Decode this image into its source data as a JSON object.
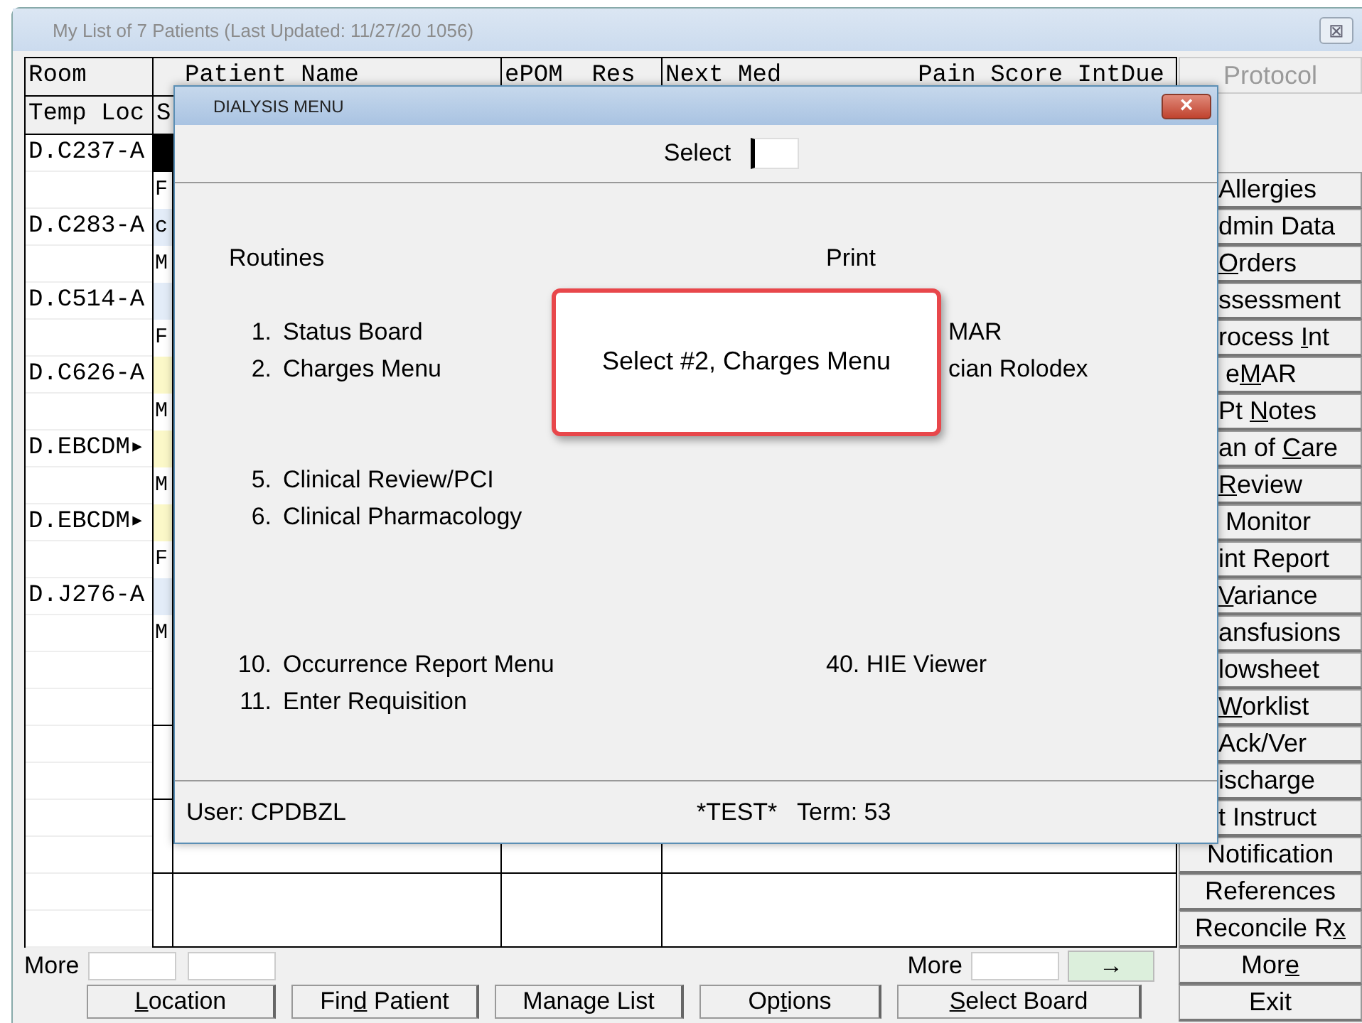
{
  "window": {
    "title": "My List of 7 Patients (Last Updated: 11/27/20  1056)",
    "close": "⊠"
  },
  "table": {
    "header_1": {
      "room": "Room",
      "patient_name": "Patient Name",
      "epom_res": "ePOM  Res",
      "next_med": "Next Med",
      "pain_score": "Pain Score IntDue"
    },
    "header_2": {
      "room": "Temp Loc",
      "status": "S"
    },
    "rows": [
      {
        "room": "D.C237-A",
        "status": [
          {
            "color": "#000000"
          },
          {
            "text": "F",
            "color": "#ffffff"
          }
        ]
      },
      {
        "room": "D.C283-A",
        "status": [
          {
            "text": "c",
            "color": "#e3ecf8"
          },
          {
            "text": "M",
            "color": "#ffffff"
          }
        ]
      },
      {
        "room": "D.C514-A",
        "status": [
          {
            "color": "#e3ecf8"
          },
          {
            "text": "F",
            "color": "#ffffff"
          }
        ]
      },
      {
        "room": "D.C626-A",
        "status": [
          {
            "color": "#fbf8c8"
          },
          {
            "text": "M",
            "color": "#ffffff"
          }
        ]
      },
      {
        "room": "D.EBCDM▸",
        "status": [
          {
            "color": "#fbf8c8"
          },
          {
            "text": "M",
            "color": "#ffffff"
          }
        ]
      },
      {
        "room": "D.EBCDM▸",
        "status": [
          {
            "color": "#fbf8c8"
          },
          {
            "text": "F",
            "color": "#ffffff"
          }
        ]
      },
      {
        "room": "D.J276-A",
        "status": [
          {
            "color": "#e3ecf8"
          },
          {
            "text": "M",
            "color": "#ffffff"
          }
        ]
      },
      {},
      {},
      {},
      {}
    ]
  },
  "bottom": {
    "left_label": "More",
    "right_label": "More",
    "arrow": "→",
    "buttons": [
      {
        "key": "L",
        "after": "ocation"
      },
      {
        "before": "Fin",
        "key": "d",
        "after": " Patient"
      },
      {
        "before": "Mana",
        "key": "g",
        "after": "e List"
      },
      {
        "before": "Op",
        "key": "t",
        "after": "ions"
      },
      {
        "key": "S",
        "after": "elect Board"
      }
    ]
  },
  "side": {
    "protocol": {
      "label": "Protocol",
      "disabled": true
    },
    "buttons": [
      {
        "kind": "covered",
        "before": "Allergies"
      },
      {
        "kind": "covered",
        "before": "dmin Data"
      },
      {
        "kind": "covered",
        "key": "O",
        "after": "rders"
      },
      {
        "kind": "covered",
        "before": "ssessment"
      },
      {
        "kind": "covered",
        "before": "rocess ",
        "key": "I",
        "after": "nt"
      },
      {
        "kind": "covered",
        "before": " e",
        "key": "M",
        "after": "AR"
      },
      {
        "kind": "covered",
        "before": "Pt ",
        "key": "N",
        "after": "otes"
      },
      {
        "kind": "covered",
        "before": "an of ",
        "key": "C",
        "after": "are"
      },
      {
        "kind": "covered",
        "key": "R",
        "after": "eview"
      },
      {
        "kind": "covered",
        "before": " Monitor"
      },
      {
        "kind": "covered",
        "before": "int Report"
      },
      {
        "kind": "covered",
        "key": "V",
        "after": "ariance"
      },
      {
        "kind": "covered",
        "before": "ansfusions"
      },
      {
        "kind": "covered",
        "before": "lowsheet"
      },
      {
        "kind": "covered",
        "key": "W",
        "after": "orklist"
      },
      {
        "kind": "covered",
        "before": "Ack/Ver"
      },
      {
        "kind": "covered",
        "before": "ischarge"
      },
      {
        "kind": "covered",
        "before": "t Instruct"
      },
      {
        "kind": "plain",
        "before": "Notification"
      },
      {
        "kind": "plain",
        "before": "References"
      },
      {
        "kind": "plain",
        "before": "Reconcile R",
        "key": "x"
      },
      {
        "kind": "plain",
        "before": "Mor",
        "key": "e"
      },
      {
        "kind": "plain",
        "before": "Exit"
      }
    ]
  },
  "dialog": {
    "title": "DIALYSIS MENU",
    "close": "×",
    "select_label": "Select",
    "routines": {
      "heading": "Routines",
      "groups": [
        [
          {
            "number": "1.",
            "label": "Status Board"
          },
          {
            "number": "2.",
            "label": "Charges Menu"
          }
        ],
        [
          {
            "number": "5.",
            "label": "Clinical Review/PCI"
          },
          {
            "number": "6.",
            "label": "Clinical Pharmacology"
          }
        ],
        [
          {
            "number": "10.",
            "label": "Occurrence Report Menu"
          },
          {
            "number": "11.",
            "label": "Enter Requisition"
          }
        ]
      ]
    },
    "print": {
      "heading": "Print",
      "groups": [
        [
          {
            "kind": "cut",
            "label": "MAR"
          },
          {
            "kind": "cut",
            "label": "cian Rolodex"
          }
        ],
        [
          {
            "kind": "full",
            "label": "40. HIE Viewer"
          }
        ]
      ]
    },
    "user": "User: CPDBZL",
    "term": "*TEST*   Term: 53"
  },
  "callout": {
    "text": "Select #2, Charges Menu"
  }
}
